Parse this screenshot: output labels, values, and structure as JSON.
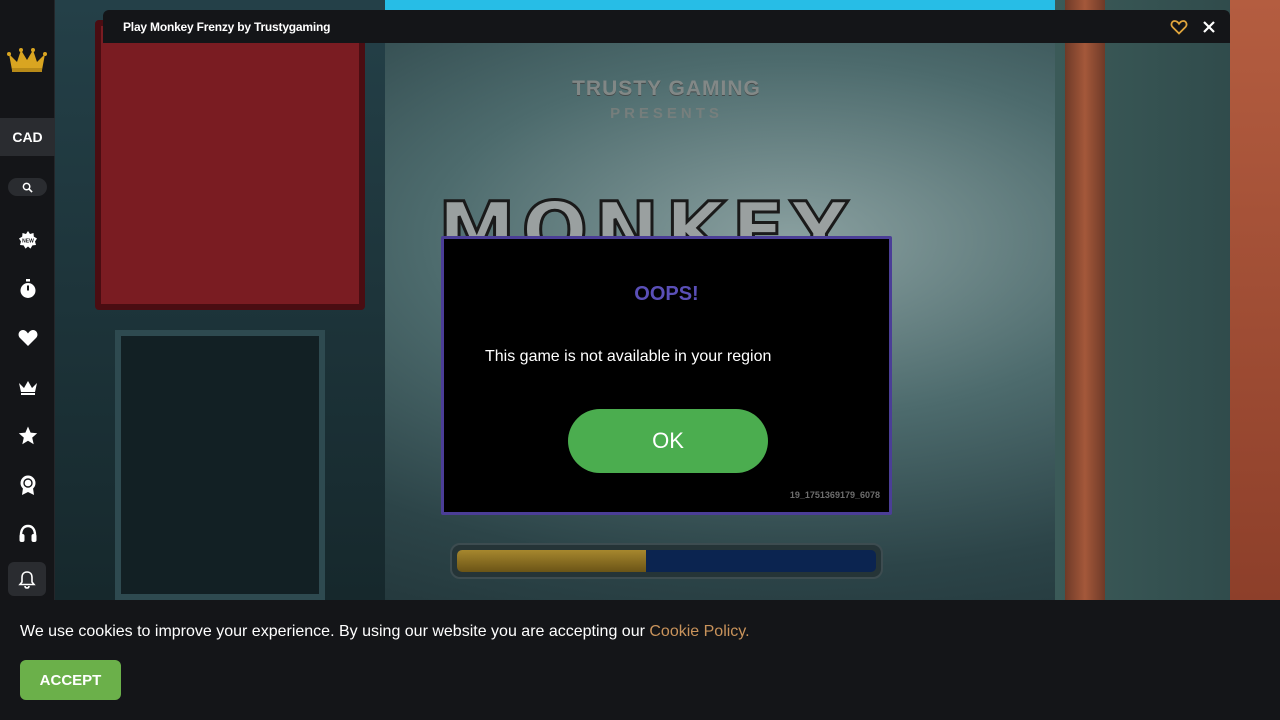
{
  "sidebar": {
    "currency": "CAD",
    "icons": [
      "crown-logo-icon",
      "search-icon",
      "new-badge-icon",
      "stopwatch-icon",
      "heart-icon",
      "crown-icon",
      "star-icon",
      "award-icon",
      "headset-icon",
      "bell-icon"
    ]
  },
  "game_window": {
    "title": "Play Monkey Frenzy by Trustygaming",
    "presents_line1": "TRUSTY GAMING",
    "presents_line2": "PRESENTS",
    "logo_text": "MONKEY",
    "loading_progress": 0.45
  },
  "modal": {
    "title": "OOPS!",
    "message": "This game is not available in your region",
    "ok_label": "OK",
    "error_code": "19_1751369179_6078"
  },
  "cookie_bar": {
    "text": "We use cookies to improve your experience. By using our website you are accepting our ",
    "link_text": "Cookie Policy.",
    "accept_label": "ACCEPT"
  },
  "colors": {
    "modal_title": "#5a4fb7",
    "ok_button": "#4bad4f",
    "accept_button": "#6bb04a",
    "cookie_link": "#c9935b"
  }
}
